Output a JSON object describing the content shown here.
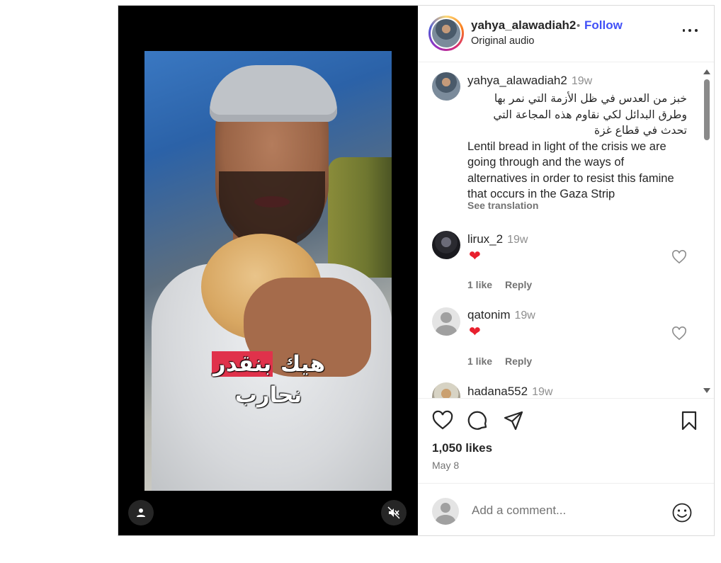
{
  "video": {
    "caption_plain": "هيك ",
    "caption_highlight": "بنقدر",
    "caption_rest": " نحارب",
    "user_icon": "user-icon",
    "mute_icon": "muted-speaker-icon"
  },
  "header": {
    "username": "yahya_alawadiah2",
    "separator": "•",
    "follow_label": "Follow",
    "audio_label": "Original audio",
    "more_icon": "more-options-icon"
  },
  "post_caption": {
    "username": "yahya_alawadiah2",
    "time": "19w",
    "text_arabic": "خبز من العدس في ظل الأزمة التي نمر بها وطرق البدائل لكي نقاوم هذه المجاعة التي تحدث في قطاع غزة",
    "text_english": "Lentil bread in light of the crisis we are going through and the ways of alternatives in order to resist this famine that occurs in the Gaza Strip",
    "see_translation": "See translation"
  },
  "comments": [
    {
      "username": "lirux_2",
      "time": "19w",
      "text": "❤",
      "likes": "1 like",
      "reply": "Reply"
    },
    {
      "username": "qatonim",
      "time": "19w",
      "text": "❤",
      "likes": "1 like",
      "reply": "Reply"
    },
    {
      "username": "hadana552",
      "time": "19w"
    }
  ],
  "actions": {
    "likes": "1,050 likes",
    "date": "May 8",
    "icons": [
      "heart-icon",
      "comment-icon",
      "share-icon",
      "bookmark-icon"
    ]
  },
  "add_comment": {
    "placeholder": "Add a comment...",
    "emoji_icon": "emoji-icon"
  },
  "colors": {
    "follow": "#4150f7",
    "heart": "#e8202e",
    "caption_highlight": "#e0324b"
  }
}
